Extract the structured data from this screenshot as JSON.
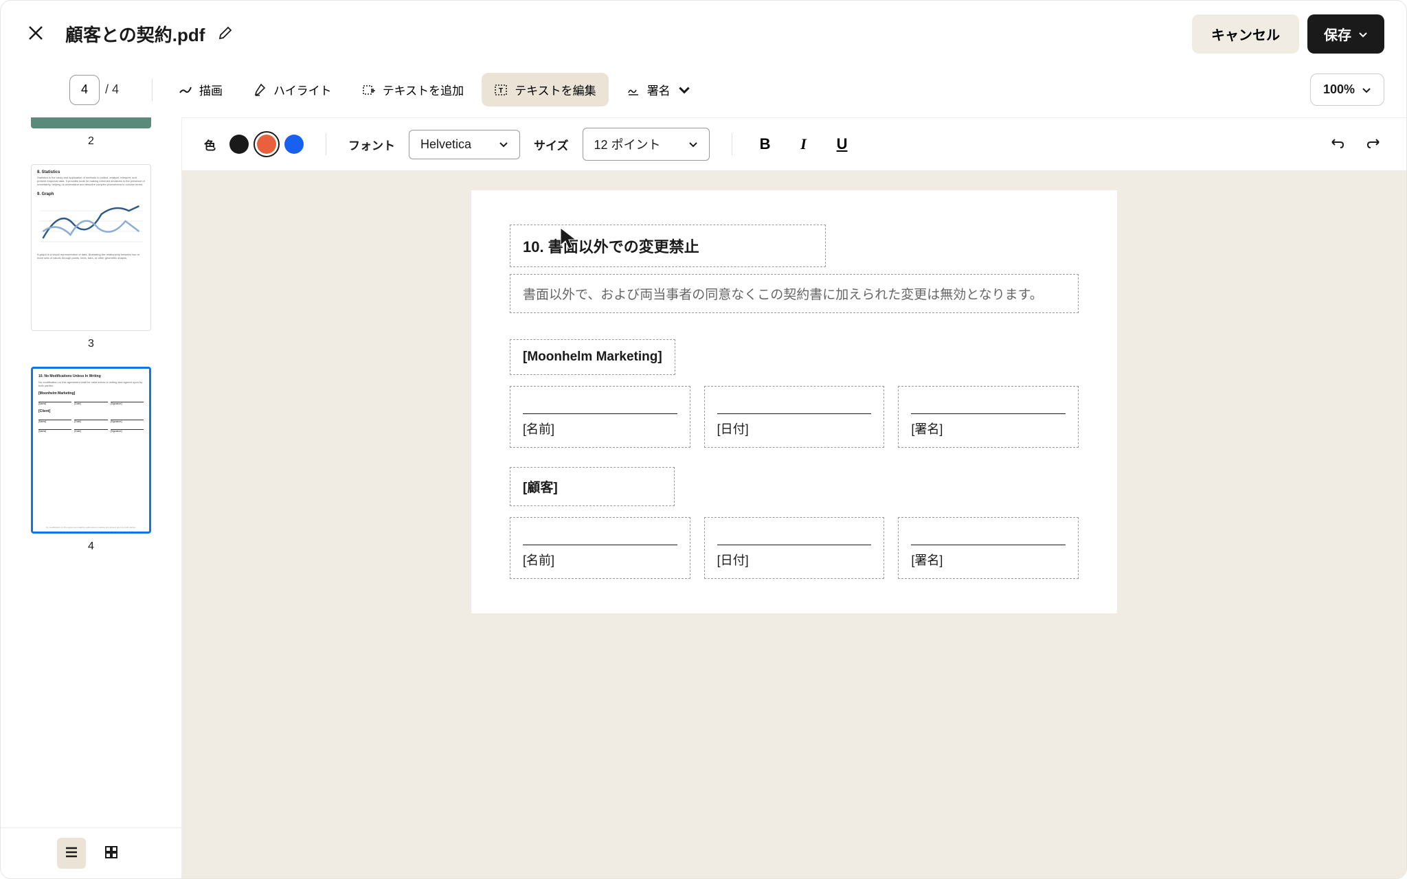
{
  "header": {
    "title": "顧客との契約.pdf",
    "cancel_label": "キャンセル",
    "save_label": "保存"
  },
  "toolbar": {
    "current_page": "4",
    "total_pages": "/ 4",
    "draw_label": "描画",
    "highlight_label": "ハイライト",
    "add_text_label": "テキストを追加",
    "edit_text_label": "テキストを編集",
    "sign_label": "署名",
    "zoom_label": "100%"
  },
  "sub_toolbar": {
    "color_label": "色",
    "font_label": "フォント",
    "font_value": "Helvetica",
    "size_label": "サイズ",
    "size_value": "12 ポイント",
    "colors": {
      "black": "#1a1a1a",
      "orange": "#e8613c",
      "blue": "#1760f0"
    }
  },
  "thumbnails": {
    "page2_label": "2",
    "page3_label": "3",
    "page4_label": "4"
  },
  "document": {
    "heading": "10. 書面以外での変更禁止",
    "body": "書面以外で、および両当事者の同意なくこの契約書に加えられた変更は無効となります。",
    "party1": "[Moonhelm Marketing]",
    "party2": "[顧客]",
    "name_label": "[名前]",
    "date_label": "[日付]",
    "signature_label": "[署名]"
  }
}
